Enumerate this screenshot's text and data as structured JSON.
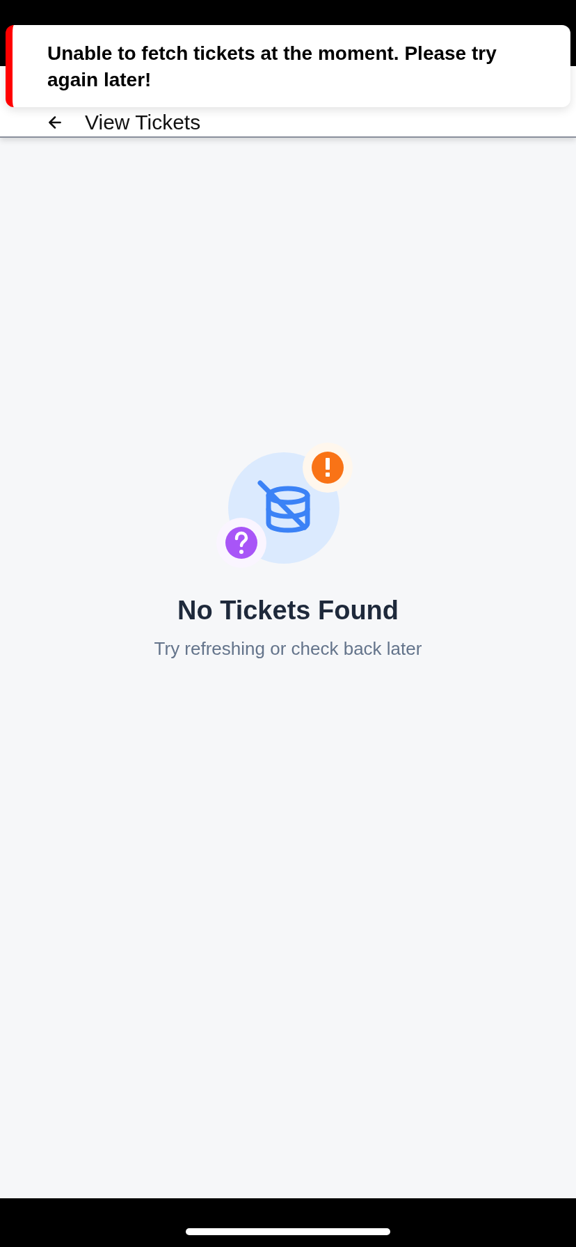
{
  "toast": {
    "kind": "error",
    "message": "Unable to fetch tickets at the moment. Please try again later!"
  },
  "header": {
    "title": "View Tickets"
  },
  "empty_state": {
    "title": "No Tickets Found",
    "subtitle": "Try refreshing or check back later"
  }
}
